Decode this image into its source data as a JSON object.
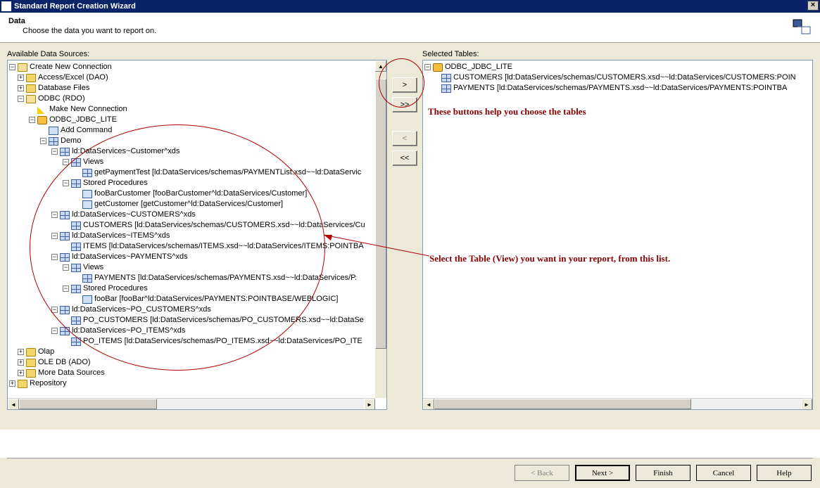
{
  "window": {
    "title": "Standard Report Creation Wizard"
  },
  "header": {
    "title": "Data",
    "subtitle": "Choose the data you want to report on."
  },
  "labels": {
    "available": "Available Data Sources:",
    "selected": "Selected Tables:"
  },
  "tree": {
    "root": "Create New Connection",
    "n0": "Access/Excel (DAO)",
    "n1": "Database Files",
    "n2": "ODBC (RDO)",
    "n2a": "Make New Connection",
    "n2b": "ODBC_JDBC_LITE",
    "n2b0": "Add Command",
    "n2b1": "Demo",
    "ds_cust": "ld:DataServices~Customer^xds",
    "views": "Views",
    "v_getPay": "getPaymentTest [ld:DataServices/schemas/PAYMENTList.xsd~~ld:DataServic",
    "sp": "Stored Procedures",
    "sp_fooBarCust": "fooBarCustomer [fooBarCustomer^ld:DataServices/Customer]",
    "sp_getCust": "getCustomer [getCustomer^ld:DataServices/Customer]",
    "ds_CUSTOMERS": "ld:DataServices~CUSTOMERS^xds",
    "t_CUSTOMERS": "CUSTOMERS [ld:DataServices/schemas/CUSTOMERS.xsd~~ld:DataServices/Cu",
    "ds_ITEMS": "ld:DataServices~ITEMS^xds",
    "t_ITEMS": "ITEMS [ld:DataServices/schemas/ITEMS.xsd~~ld:DataServices/ITEMS:POINTBA",
    "ds_PAYMENTS": "ld:DataServices~PAYMENTS^xds",
    "t_PAYMENTS": "PAYMENTS [ld:DataServices/schemas/PAYMENTS.xsd~~ld:DataServices/P.",
    "sp_fooBar": "fooBar [fooBar^ld:DataServices/PAYMENTS:POINTBASE/WEBLOGIC]",
    "ds_POCUST": "ld:DataServices~PO_CUSTOMERS^xds",
    "t_POCUST": "PO_CUSTOMERS [ld:DataServices/schemas/PO_CUSTOMERS.xsd~~ld:DataSe",
    "ds_POITEMS": "ld:DataServices~PO_ITEMS^xds",
    "t_POITEMS": "PO_ITEMS [ld:DataServices/schemas/PO_ITEMS.xsd~~ld:DataServices/PO_ITE",
    "n3": "Olap",
    "n4": "OLE DB (ADO)",
    "n5": "More Data Sources",
    "repo": "Repository"
  },
  "selected": {
    "root": "ODBC_JDBC_LITE",
    "s0": "CUSTOMERS [ld:DataServices/schemas/CUSTOMERS.xsd~~ld:DataServices/CUSTOMERS:POIN",
    "s1": "PAYMENTS [ld:DataServices/schemas/PAYMENTS.xsd~~ld:DataServices/PAYMENTS:POINTBA"
  },
  "annot": {
    "a1": "These buttons help you choose the tables",
    "a2": "Select the Table (View) you want in your report, from this list."
  },
  "buttons": {
    "back": "< Back",
    "next": "Next >",
    "finish": "Finish",
    "cancel": "Cancel",
    "help": "Help"
  },
  "glyph": {
    "plus": "+",
    "minus": "−",
    "right": ">",
    "right2": ">>",
    "left": "<",
    "left2": "<<",
    "x": "×",
    "al": "◄",
    "ar": "►",
    "au": "▲",
    "ad": "▼"
  }
}
